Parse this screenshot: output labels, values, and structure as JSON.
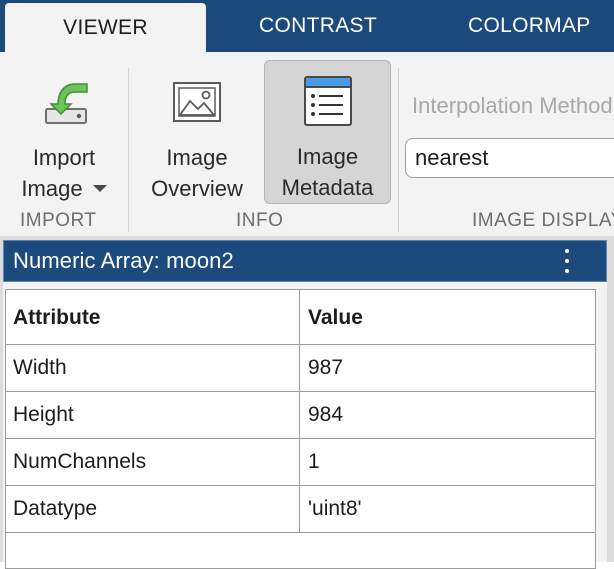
{
  "tabs": [
    {
      "label": "VIEWER",
      "active": true
    },
    {
      "label": "CONTRAST",
      "active": false
    },
    {
      "label": "COLORMAP",
      "active": false
    }
  ],
  "ribbon": {
    "import_section": {
      "label": "IMPORT",
      "import_button": {
        "line1": "Import",
        "line2": "Image",
        "icon": "import-arrow-icon"
      }
    },
    "info_section": {
      "label": "INFO",
      "overview_button": {
        "line1": "Image",
        "line2": "Overview",
        "icon": "image-picture-icon"
      },
      "metadata_button": {
        "line1": "Image",
        "line2": "Metadata",
        "icon": "metadata-list-icon",
        "selected": true
      }
    },
    "display_section": {
      "label": "IMAGE DISPLAY",
      "interpolation_label": "Interpolation Method",
      "interpolation_value": "nearest"
    }
  },
  "panel": {
    "title": "Numeric Array: moon2",
    "columns": [
      "Attribute",
      "Value"
    ],
    "rows": [
      {
        "attribute": "Width",
        "value": "987"
      },
      {
        "attribute": "Height",
        "value": "984"
      },
      {
        "attribute": "NumChannels",
        "value": "1"
      },
      {
        "attribute": "Datatype",
        "value": "'uint8'"
      }
    ]
  },
  "colors": {
    "tab_bar": "#1c4a7c",
    "ribbon_bg": "#f3f3f3",
    "import_icon_green": "#5cb85c",
    "metadata_icon_blue": "#3d8fd9"
  }
}
